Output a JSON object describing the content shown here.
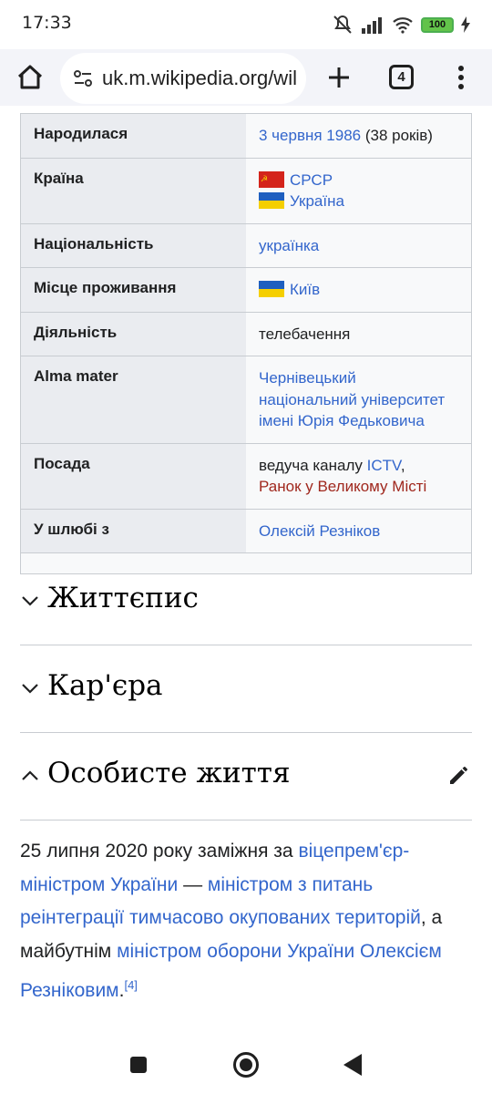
{
  "status": {
    "time": "17:33",
    "battery": "100"
  },
  "browser": {
    "url": "uk.m.wikipedia.org/wil",
    "tab_count": "4"
  },
  "infobox": {
    "born_label": "Народилася",
    "born_date": "3 червня 1986",
    "born_age": " (38 років)",
    "country_label": "Країна",
    "country_1": "СРСР",
    "country_2": "Україна",
    "nationality_label": "Національність",
    "nationality": "українка",
    "residence_label": "Місце проживання",
    "residence": "Київ",
    "activity_label": "Діяльність",
    "activity": "телебачення",
    "alma_label": "Alma mater",
    "alma": "Чернівецький національний університет імені Юрія Федьковича",
    "position_label": "Посада",
    "position_prefix": "ведуча каналу ",
    "position_channel": "ICTV",
    "position_comma": ",",
    "position_show": "Ранок у Великому Місті",
    "spouse_label": "У шлюбі з",
    "spouse": "Олексій Резніков"
  },
  "sections": {
    "biography": "Життєпис",
    "career": "Кар'єра",
    "personal": "Особисте життя"
  },
  "paragraph": {
    "t1": "25 липня 2020 року заміжня за ",
    "l1": "віцепрем'єр-міністром України",
    "t2": " — ",
    "l2": "міністром з питань реінтеграції тимчасово окупованих територій",
    "t3": ", а майбутнім ",
    "l3": "міністром оборони України Олексієм Резніковим",
    "t4": ".",
    "ref": "[4]"
  },
  "colors": {
    "link": "#3366cc",
    "red_link": "#a0281e",
    "infobox_label_bg": "#eaecf0"
  },
  "icons": [
    "home-icon",
    "site-settings-icon",
    "new-tab-icon",
    "tab-switcher-icon",
    "overflow-menu-icon",
    "chevron-down-icon",
    "chevron-up-icon",
    "edit-pencil-icon"
  ]
}
